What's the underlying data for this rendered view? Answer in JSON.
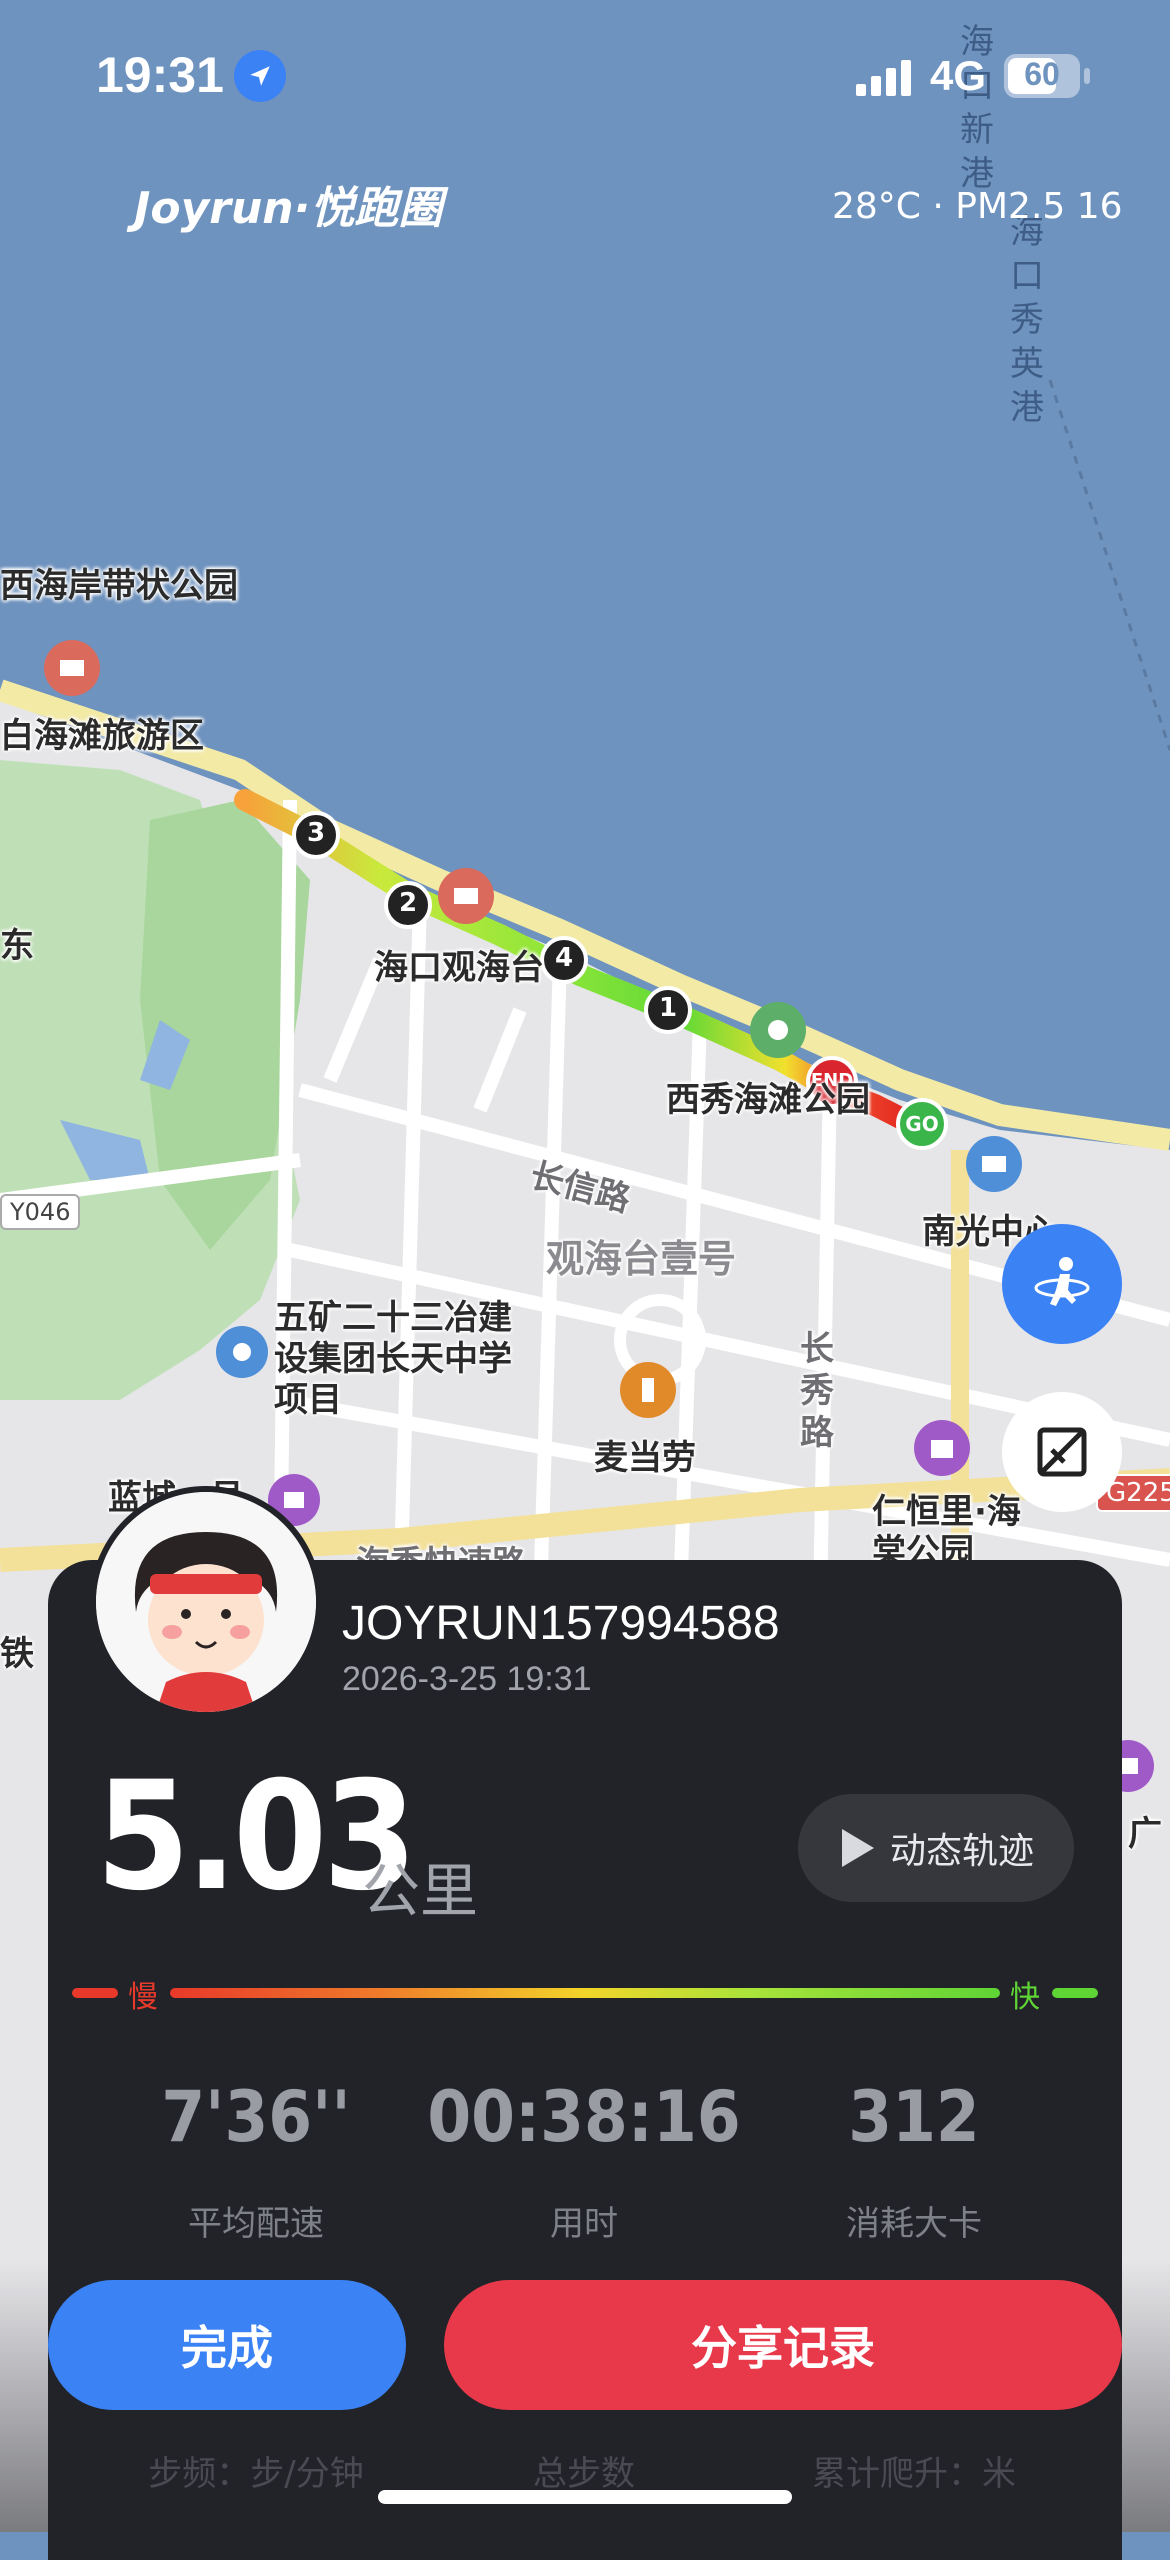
{
  "status_bar": {
    "time": "19:31",
    "signal": "4G",
    "battery": "60"
  },
  "brand": {
    "logo_text": "Joyrun·悦跑圈"
  },
  "weather": {
    "text": "28°C · PM2.5 16"
  },
  "map": {
    "labels": {
      "port": "海口新港",
      "port2": "海口秀英港",
      "west_coast_park": "西海岸带状公园",
      "beach_area": "白海滩旅游区",
      "guanhai": "海口观海台",
      "xixiu_park": "西秀海滩公园",
      "changxin_road": "长信路",
      "guanhaitai_yihao": "观海台壹号",
      "nanguang": "南光中心",
      "project": "五矿二十三冶建设集团长天中学项目",
      "mcdonalds": "麦当劳",
      "changxiu_road": "长秀路",
      "renhengli": "仁恒里·海棠公园",
      "lancheng": "蓝城一号",
      "road_code": "Y046",
      "highway": "G225",
      "edge_left": "东",
      "edge_left2": "铁",
      "edge_right": "广",
      "express": "海秀快速路"
    },
    "route_markers": [
      "1",
      "2",
      "3",
      "4"
    ],
    "start_marker": "GO",
    "end_marker": "END"
  },
  "colors": {
    "accent_blue": "#3b82f5",
    "accent_red": "#e8394b",
    "card_bg": "#222328",
    "fast": "#5fd435",
    "slow": "#e8392a"
  },
  "run": {
    "username": "JOYRUN157994588",
    "datetime": "2026-3-25 19:31",
    "distance": "5.03",
    "distance_unit": "公里",
    "replay_label": "动态轨迹",
    "pace_slow_label": "慢",
    "pace_fast_label": "快",
    "stats": [
      {
        "value": "7'36''",
        "label": "平均配速"
      },
      {
        "value": "00:38:16",
        "label": "用时"
      },
      {
        "value": "312",
        "label": "消耗大卡"
      }
    ],
    "extra_stats": [
      {
        "label": "步频：步/分钟"
      },
      {
        "label": "总步数"
      },
      {
        "label": "累计爬升：米"
      }
    ]
  },
  "actions": {
    "done_label": "完成",
    "share_label": "分享记录"
  }
}
